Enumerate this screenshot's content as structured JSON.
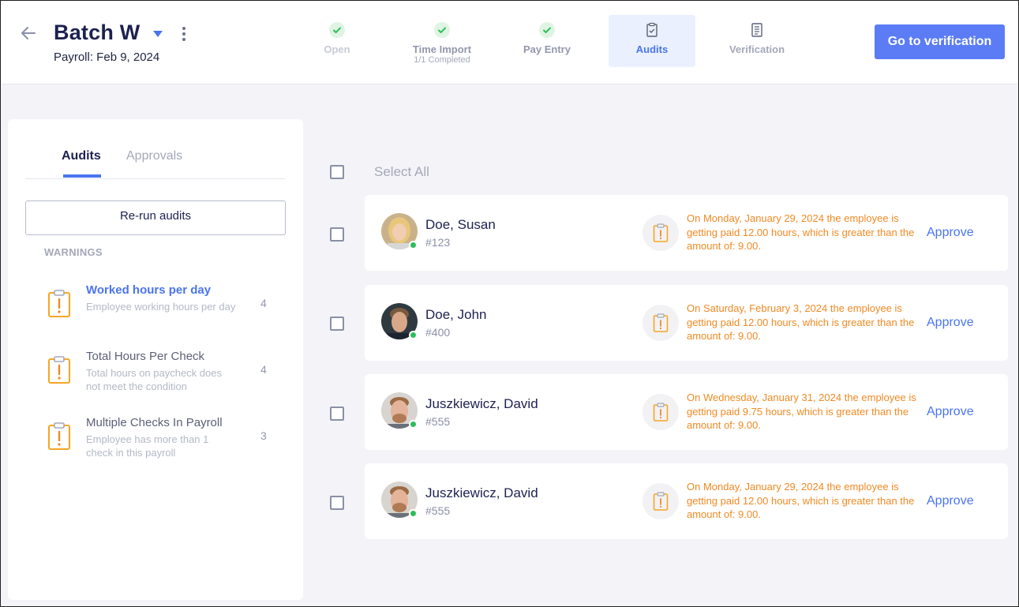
{
  "header": {
    "batch_title": "Batch W",
    "subtitle": "Payroll: Feb 9, 2024",
    "go_button": "Go to verification"
  },
  "steps": [
    {
      "label": "Open",
      "sub": "",
      "state": "done"
    },
    {
      "label": "Time Import",
      "sub": "1/1 Completed",
      "state": "done"
    },
    {
      "label": "Pay Entry",
      "sub": "",
      "state": "done"
    },
    {
      "label": "Audits",
      "sub": "",
      "state": "active"
    },
    {
      "label": "Verification",
      "sub": "",
      "state": "pending"
    }
  ],
  "sidebar": {
    "tabs": [
      "Audits",
      "Approvals"
    ],
    "rerun_button": "Re-run audits",
    "warnings_heading": "WARNINGS",
    "warnings": [
      {
        "title": "Worked hours per day",
        "desc": "Employee working hours per day",
        "count": "4"
      },
      {
        "title": "Total Hours Per Check",
        "desc": "Total hours on paycheck does not meet the condition",
        "count": "4"
      },
      {
        "title": "Multiple Checks In Payroll",
        "desc": "Employee has more than 1 check in this payroll",
        "count": "3"
      }
    ]
  },
  "main": {
    "select_all": "Select All",
    "rows": [
      {
        "name": "Doe, Susan",
        "id": "#123",
        "message": "On Monday, January 29, 2024 the employee is getting paid 12.00 hours, which is greater than the amount of: 9.00.",
        "action": "Approve"
      },
      {
        "name": "Doe, John",
        "id": "#400",
        "message": "On Saturday, February 3, 2024 the employee is getting paid 12.00 hours, which is greater than the amount of: 9.00.",
        "action": "Approve"
      },
      {
        "name": "Juszkiewicz, David",
        "id": "#555",
        "message": "On Wednesday, January 31, 2024 the employee is getting paid 9.75 hours, which is greater than the amount of: 9.00.",
        "action": "Approve"
      },
      {
        "name": "Juszkiewicz, David",
        "id": "#555",
        "message": "On Monday, January 29, 2024 the employee is getting paid 12.00 hours, which is greater than the amount of: 9.00.",
        "action": "Approve"
      }
    ]
  },
  "colors": {
    "accent": "#4a74f0",
    "button": "#5b7cf5",
    "warning": "#f08a24",
    "online": "#2ebd59",
    "done_check": "#2ebd59"
  },
  "icons": [
    "back-arrow-icon",
    "caret-down-icon",
    "more-vertical-icon",
    "check-icon",
    "clipboard-check-icon",
    "document-icon",
    "clipboard-warning-icon"
  ]
}
